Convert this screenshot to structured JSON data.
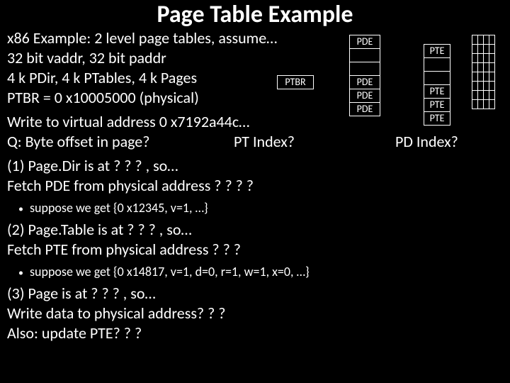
{
  "title": "Page Table Example",
  "lines": {
    "l1": "x86 Example: 2 level page tables, assume…",
    "l2": "32 bit vaddr, 32 bit paddr",
    "l3": "4 k PDir, 4 k PTables, 4 k Pages",
    "l4": "PTBR = 0 x10005000 (physical)",
    "l5": "Write to virtual address 0 x7192a44c…",
    "q_byte": "Q: Byte offset in page?",
    "q_pt": "PT Index?",
    "q_pd": "PD Index?",
    "l7": "(1) Page.Dir is at ? ? ? , so…",
    "l8": "Fetch PDE from physical address ? ? ? ?",
    "b1": "suppose we get {0 x12345, v=1, …}",
    "l9": "(2) Page.Table is at ? ? ? , so…",
    "l10": "Fetch PTE from physical address ? ? ?",
    "b2": "suppose we get {0 x14817, v=1, d=0, r=1, w=1, x=0, …}",
    "l11": "(3) Page is at ? ? ? , so…",
    "l12": "Write data to physical address? ? ?",
    "l13": "Also: update PTE? ? ?"
  },
  "labels": {
    "ptbr": "PTBR",
    "pde": "PDE",
    "pte": "PTE"
  }
}
